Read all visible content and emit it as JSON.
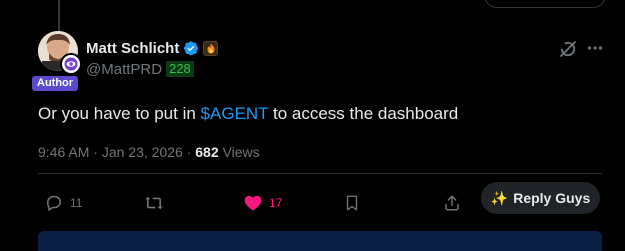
{
  "post": {
    "author": {
      "display_name": "Matt Schlicht",
      "handle": "@MattPRD",
      "score": "228",
      "role_badge": "Author"
    },
    "text_before": "Or you have to put in ",
    "cashtag": "$AGENT",
    "text_after": " to access the dashboard",
    "time": "9:46 AM",
    "date": "Jan 23, 2026",
    "separator": "·",
    "views_count": "682",
    "views_label": "Views"
  },
  "actions": {
    "replies": "11",
    "reposts": "",
    "likes": "17",
    "reply_guys_label": "Reply Guys",
    "reply_guys_emoji": "✨"
  },
  "icons": {
    "verified": "verified-badge-icon",
    "grok": "grok-icon",
    "more": "more-options-icon",
    "reply": "reply-icon",
    "repost": "repost-icon",
    "like": "heart-icon",
    "bookmark": "bookmark-icon",
    "share": "share-icon"
  },
  "colors": {
    "background": "#000000",
    "text_primary": "#e7e9ea",
    "text_secondary": "#71767b",
    "link_blue": "#1d9bf0",
    "like_pink": "#f91880",
    "author_badge": "#5b4bcc",
    "score_green": "#33c44d"
  }
}
